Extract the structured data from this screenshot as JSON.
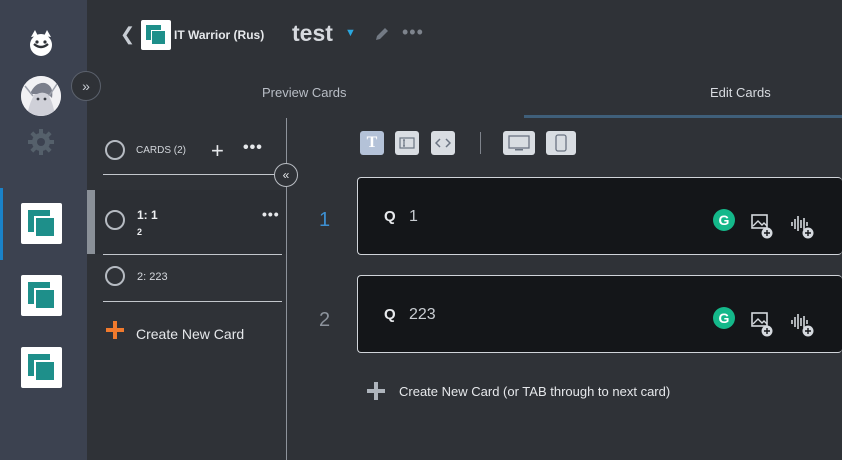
{
  "header": {
    "workspace_name": "IT Warrior (Rus)",
    "deck_title": "test",
    "back_icon": "chevron-left-icon",
    "edit_icon": "pencil-icon",
    "more_icon": "more-horizontal-icon"
  },
  "tabs": [
    {
      "label": "Preview Cards",
      "active": false
    },
    {
      "label": "Edit Cards",
      "active": true
    }
  ],
  "card_list": {
    "header_label": "CARDS (2)",
    "items": [
      {
        "title": "1: 1",
        "subtitle": "2",
        "selected": true
      },
      {
        "title": "2: 223",
        "subtitle": "",
        "selected": false
      }
    ],
    "create_label": "Create New Card"
  },
  "cards": [
    {
      "number": "1",
      "q_label": "Q",
      "question": "1",
      "active": true
    },
    {
      "number": "2",
      "q_label": "Q",
      "question": "223",
      "active": false
    }
  ],
  "create_next_label": "Create New Card (or TAB through to next card)",
  "toolbar": {
    "text_tool": "T",
    "items": [
      "text-format-icon",
      "textbox-icon",
      "code-icon",
      "desktop-preview-icon",
      "mobile-preview-icon"
    ]
  },
  "grammarly_glyph": "G",
  "colors": {
    "accent": "#1a82c8",
    "brand_teal": "#1e8f8a",
    "create_orange": "#f07a2d",
    "grammarly_green": "#14b88a"
  }
}
